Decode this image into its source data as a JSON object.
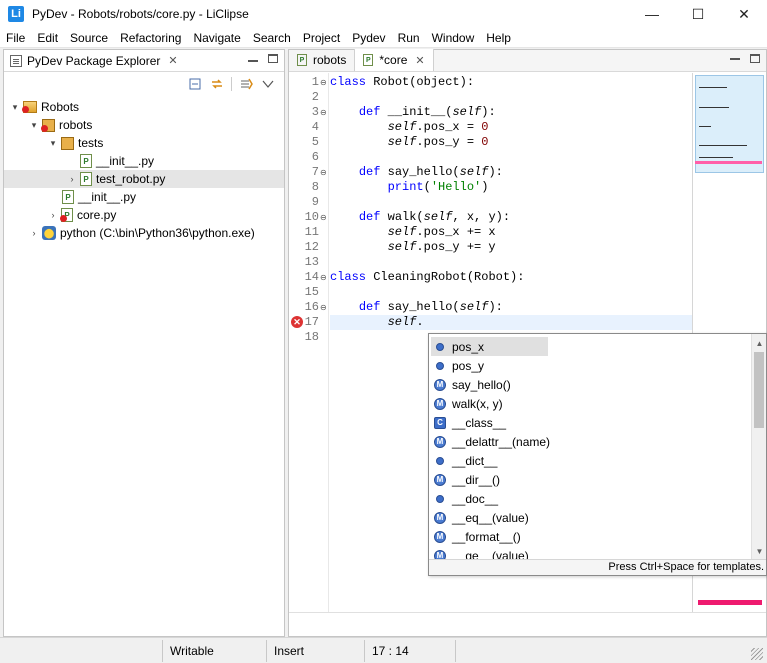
{
  "window": {
    "title": "PyDev - Robots/robots/core.py - LiClipse",
    "app_icon_letter": "Li",
    "minimize": "—",
    "maximize": "☐",
    "close": "✕"
  },
  "menu": [
    "File",
    "Edit",
    "Source",
    "Refactoring",
    "Navigate",
    "Search",
    "Project",
    "Pydev",
    "Run",
    "Window",
    "Help"
  ],
  "explorer": {
    "tab_label": "PyDev Package Explorer",
    "tab_close": "✕",
    "tree": [
      {
        "label": "Robots",
        "icon": "project-icon",
        "twisty": "▾"
      },
      {
        "label": "robots",
        "icon": "package-icon",
        "twisty": "▾"
      },
      {
        "label": "tests",
        "icon": "package-icon",
        "twisty": "▾"
      },
      {
        "label": "__init__.py",
        "icon": "python-file-icon",
        "twisty": ""
      },
      {
        "label": "test_robot.py",
        "icon": "python-file-icon",
        "twisty": "›"
      },
      {
        "label": "__init__.py",
        "icon": "python-file-icon",
        "twisty": ""
      },
      {
        "label": "core.py",
        "icon": "python-file-error-icon",
        "twisty": "›"
      },
      {
        "label": "python  (C:\\bin\\Python36\\python.exe)",
        "icon": "python-interpreter-icon",
        "twisty": "›"
      }
    ]
  },
  "editor": {
    "tabs": [
      {
        "label": "robots",
        "icon": "P"
      },
      {
        "label": "*core",
        "icon": "P",
        "close": "✕"
      }
    ],
    "line_numbers": [
      "1",
      "2",
      "3",
      "4",
      "5",
      "6",
      "7",
      "8",
      "9",
      "10",
      "11",
      "12",
      "13",
      "14",
      "15",
      "16",
      "17",
      "18"
    ],
    "fold_marks": {
      "1": "⊖",
      "3": "⊖",
      "7": "⊖",
      "10": "⊖",
      "14": "⊖",
      "16": "⊖"
    },
    "error_line_marker": "✕"
  },
  "autocomplete": {
    "items": [
      {
        "label": "pos_x",
        "kind": "attr"
      },
      {
        "label": "pos_y",
        "kind": "attr"
      },
      {
        "label": "say_hello()",
        "kind": "method"
      },
      {
        "label": "walk(x, y)",
        "kind": "method"
      },
      {
        "label": "__class__",
        "kind": "class"
      },
      {
        "label": "__delattr__(name)",
        "kind": "method"
      },
      {
        "label": "__dict__",
        "kind": "attr"
      },
      {
        "label": "__dir__()",
        "kind": "method"
      },
      {
        "label": "__doc__",
        "kind": "attr"
      },
      {
        "label": "__eq__(value)",
        "kind": "method"
      },
      {
        "label": "__format__()",
        "kind": "method"
      },
      {
        "label": "__ge__(value)",
        "kind": "method"
      }
    ],
    "hint": "Press Ctrl+Space for templates.",
    "method_glyph": "M",
    "class_glyph": "C"
  },
  "status": {
    "writable": "Writable",
    "insert_mode": "Insert",
    "position": "17 : 14"
  }
}
